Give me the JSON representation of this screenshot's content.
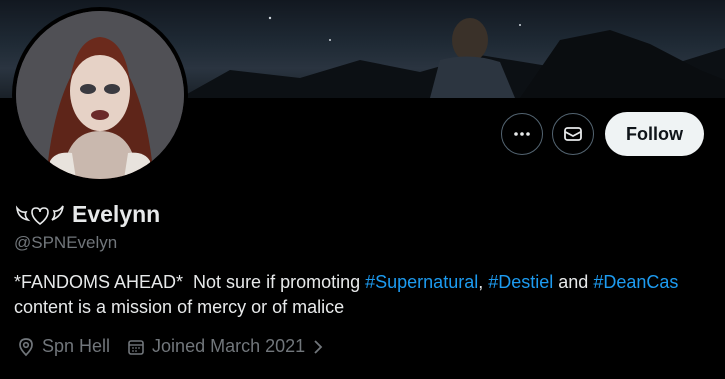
{
  "profile": {
    "display_name": "Evelynn",
    "handle": "@SPNEvelyn",
    "bio": {
      "prefix": "*FANDOMS AHEAD*  Not sure if promoting ",
      "tag1": "#Supernatural",
      "sep1": ", ",
      "tag2": "#Destiel",
      "sep2": " and ",
      "tag3": "#DeanCas",
      "line2": "content is a mission of mercy or of malice"
    },
    "location": "Spn Hell",
    "joined": "Joined March 2021"
  },
  "actions": {
    "follow_label": "Follow",
    "more_icon": "more-icon",
    "message_icon": "envelope-icon"
  },
  "colors": {
    "accent": "#1d9bf0",
    "muted": "#71767b",
    "text": "#e7e9ea",
    "background": "#000000"
  }
}
